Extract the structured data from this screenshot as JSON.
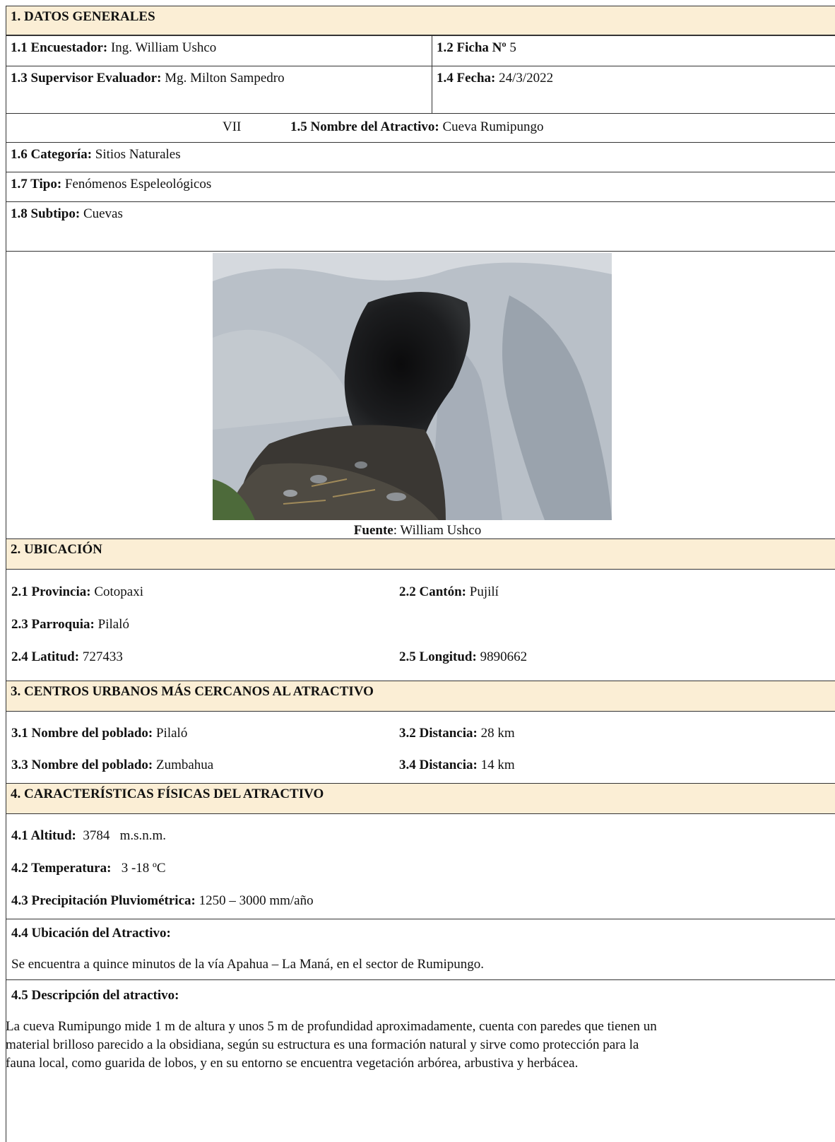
{
  "s1": {
    "title": "1. DATOS GENERALES",
    "encuestador_label": "1.1 Encuestador:",
    "encuestador": "Ing. William Ushco",
    "ficha_label": "1.2 Ficha Nº",
    "ficha": "5",
    "supervisor_label": "1.3 Supervisor Evaluador:",
    "supervisor": "Mg. Milton Sampedro",
    "fecha_label": "1.4 Fecha:",
    "fecha": "24/3/2022",
    "roman": "VII",
    "nombre_label": "1.5 Nombre del Atractivo:",
    "nombre": "Cueva Rumipungo",
    "categoria_label": "1.6 Categoría:",
    "categoria": "Sitios Naturales",
    "tipo_label": "1.7 Tipo:",
    "tipo": "Fenómenos Espeleológicos",
    "subtipo_label": "1.8 Subtipo:",
    "subtipo": "Cuevas",
    "fuente_label": "Fuente",
    "fuente": ": William Ushco"
  },
  "s2": {
    "title": "2. UBICACIÓN",
    "provincia_label": "2.1 Provincia:",
    "provincia": "Cotopaxi",
    "canton_label": "2.2 Cantón:",
    "canton": "Pujilí",
    "parroquia_label": "2.3 Parroquia:",
    "parroquia": "Pilaló",
    "latitud_label": "2.4 Latitud:",
    "latitud": "727433",
    "longitud_label": "2.5 Longitud:",
    "longitud": "9890662"
  },
  "s3": {
    "title": "3. CENTROS URBANOS MÁS CERCANOS AL ATRACTIVO",
    "poblado1_label": "3.1 Nombre del poblado:",
    "poblado1": "Pilaló",
    "dist1_label": "3.2 Distancia:",
    "dist1": "28 km",
    "poblado2_label": "3.3 Nombre del poblado:",
    "poblado2": "Zumbahua",
    "dist2_label": "3.4 Distancia:",
    "dist2": "14 km"
  },
  "s4": {
    "title": "4. CARACTERÍSTICAS FÍSICAS DEL ATRACTIVO",
    "altitud_label": "4.1 Altitud:",
    "altitud": "3784   m.s.n.m.",
    "temp_label": "4.2 Temperatura:",
    "temp": "3 -18 ºC",
    "precip_label": "4.3 Precipitación Pluviométrica:",
    "precip": "1250 – 3000 mm/año",
    "ubic_title": "4.4 Ubicación del Atractivo:",
    "ubic_text": "Se encuentra a quince minutos de la vía Apahua – La Maná, en el sector de Rumipungo.",
    "desc_title": "4.5 Descripción del atractivo:",
    "desc_l1": "La cueva Rumipungo mide 1 m de altura y unos 5 m de profundidad aproximadamente, cuenta con paredes que tienen un",
    "desc_l2": "material brilloso parecido a la obsidiana, según su estructura es una formación natural y sirve como protección para la",
    "desc_l3": "fauna local, como guarida de lobos, y en su entorno se encuentra vegetación arbórea, arbustiva y herbácea."
  }
}
